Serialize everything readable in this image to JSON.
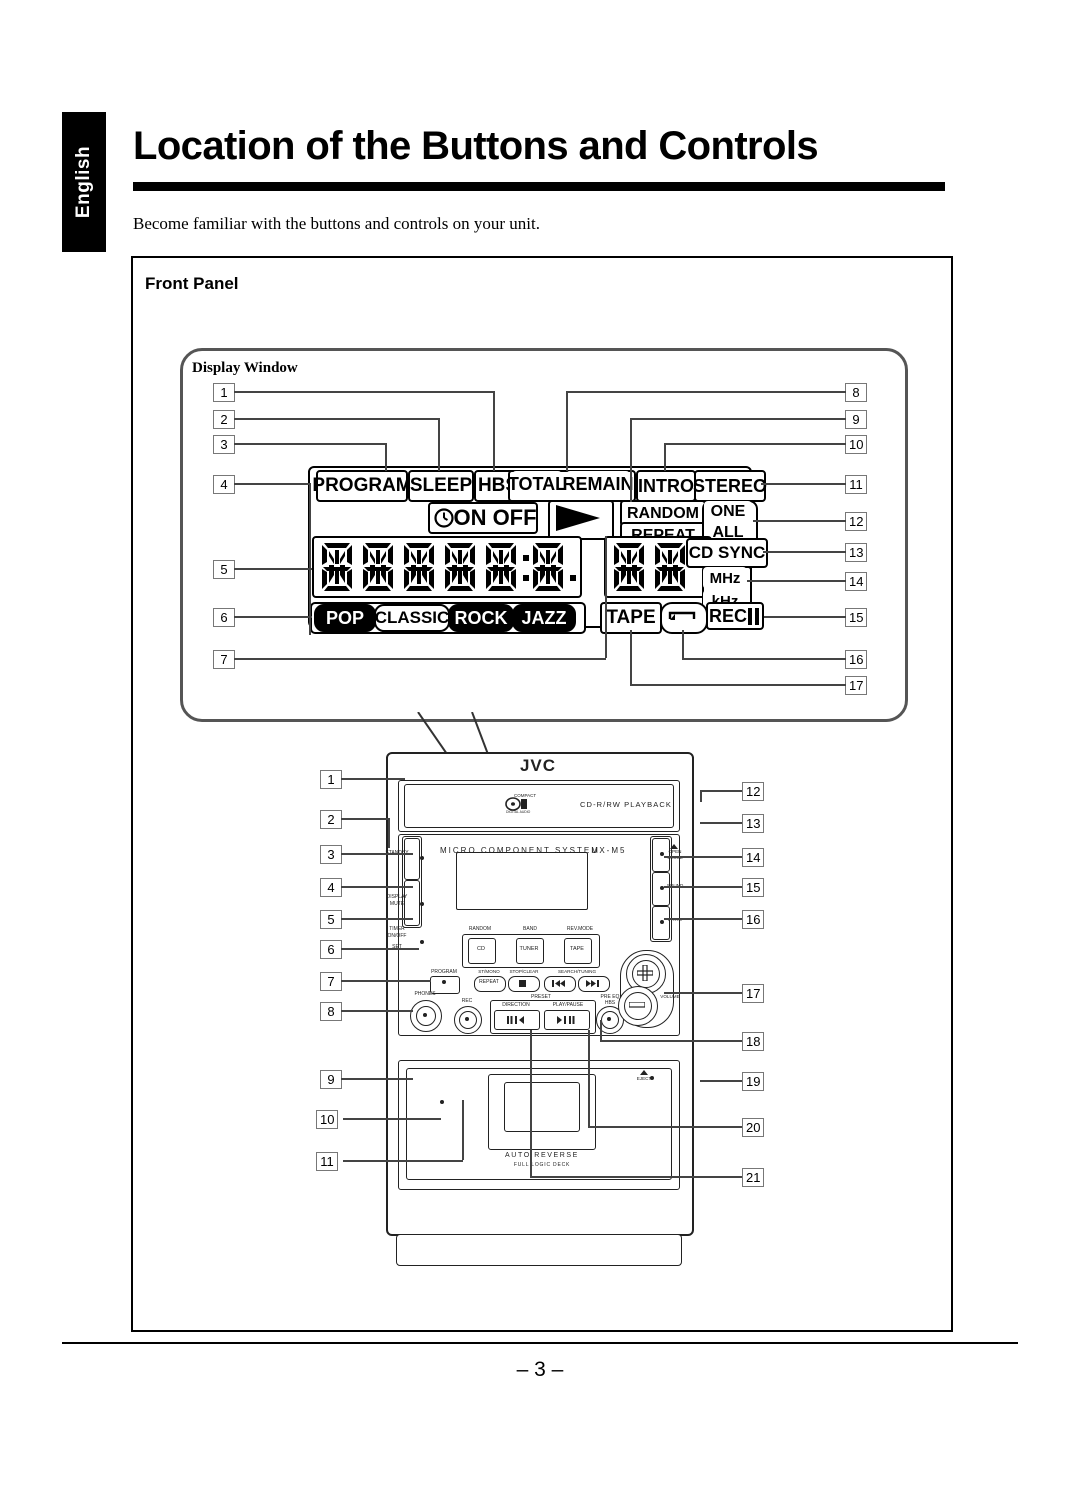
{
  "language_tab": "English",
  "page_title": "Location of the Buttons and Controls",
  "intro_text": "Become familiar with the buttons and controls on your unit.",
  "panel_heading": "Front Panel",
  "display_window": {
    "label": "Display Window",
    "indicators": {
      "program": "PROGRAM",
      "sleep": "SLEEP",
      "hbs": "HBS",
      "total": "TOTAL",
      "remain": "REMAIN",
      "intro": "INTRO",
      "stereo": "STEREO",
      "timer_on_off": "ON OFF",
      "random": "RANDOM",
      "repeat": "REPEAT",
      "one": "ONE",
      "all": "ALL",
      "cd_sync": "CD SYNC",
      "mhz": "MHz",
      "khz": "kHz",
      "tape": "TAPE",
      "rec": "REC",
      "play_icon": "play-triangle",
      "clock_icon": "clock-icon",
      "reverse_icon": "reverse-loop-icon"
    },
    "sound_modes": [
      "POP",
      "CLASSIC",
      "ROCK",
      "JAZZ"
    ],
    "sound_modes_highlighted": [
      "POP",
      "ROCK",
      "JAZZ"
    ],
    "callouts_left": [
      "1",
      "2",
      "3",
      "4",
      "5",
      "6",
      "7"
    ],
    "callouts_right": [
      "8",
      "9",
      "10",
      "11",
      "12",
      "13",
      "14",
      "15",
      "16",
      "17"
    ]
  },
  "unit": {
    "brand": "JVC",
    "cd_text": "CD-R/RW PLAYBACK",
    "compact_disc_badge": "COMPACT DISC DIGITAL AUDIO",
    "system_text": "MICRO  COMPONENT  SYSTEM",
    "model": "UX-M5",
    "deck_text": "AUTO REVERSE",
    "deck_subtext": "FULL LOGIC DECK",
    "buttons": {
      "standby": "ON/STANDBY",
      "standby_sub": "STANDBY",
      "display_mute": "DISPLAY",
      "display_mute_sub": "MUTE",
      "timer": "TIMER",
      "timer_sub": "ON/OFF",
      "timer_set": "SET",
      "phones": "PHONES",
      "rec": "REC",
      "program": "PROGRAM",
      "random_label": "RANDOM",
      "band_label": "BAND",
      "rev_mode_label": "REV.MODE",
      "cd": "CD",
      "tuner": "TUNER",
      "tape": "TAPE",
      "st_mono": "ST/MONO",
      "repeat": "REPEAT",
      "stop_clear": "STOP/CLEAR",
      "search_tuning": "SEARCH/TUNING",
      "preset": "PRESET",
      "direction": "DIRECTION",
      "play_pause": "PLAY/PAUSE",
      "pre_eq": "PRE EQ",
      "hbs": "HBS",
      "open_close": "OPEN",
      "open_close_sub": "CLOSE",
      "sound": "SOUND",
      "intro": "INTRO",
      "volume": "VOLUME",
      "eject": "EJECT",
      "stop_icon": "stop-square-icon",
      "prev_icon": "skip-back-icon",
      "next_icon": "skip-forward-icon",
      "rev_play_icon": "reverse-play-icon",
      "fwd_play_icon": "forward-play-pause-icon",
      "plus": "+",
      "minus": "–",
      "eject_icon": "eject-triangle-icon"
    },
    "callouts_left": [
      "1",
      "2",
      "3",
      "4",
      "5",
      "6",
      "7",
      "8",
      "9",
      "10",
      "11"
    ],
    "callouts_right": [
      "12",
      "13",
      "14",
      "15",
      "16",
      "17",
      "18",
      "19",
      "20",
      "21"
    ]
  },
  "page_number": "– 3 –"
}
